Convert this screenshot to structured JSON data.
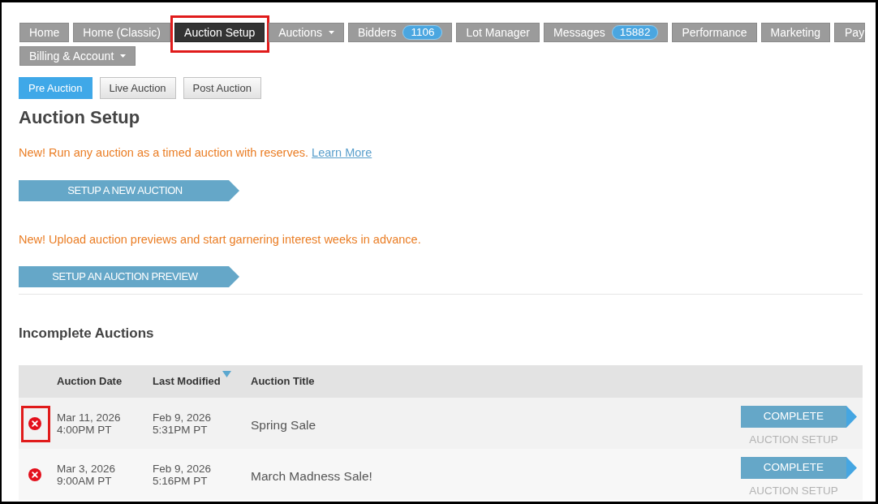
{
  "nav": {
    "rows": [
      [
        {
          "label": "Home",
          "selected": false,
          "menu": false,
          "highlighted": false
        },
        {
          "label": "Home (Classic)",
          "selected": false,
          "menu": false,
          "highlighted": false
        },
        {
          "label": "Auction Setup",
          "selected": true,
          "menu": false,
          "highlighted": true
        },
        {
          "label": "Auctions",
          "selected": false,
          "menu": true,
          "highlighted": false
        },
        {
          "label": "Bidders",
          "badge": "1106",
          "selected": false,
          "menu": false,
          "highlighted": false
        },
        {
          "label": "Lot Manager",
          "selected": false,
          "menu": false,
          "highlighted": false
        },
        {
          "label": "Messages",
          "badge": "15882",
          "selected": false,
          "menu": false,
          "highlighted": false
        },
        {
          "label": "Performance",
          "selected": false,
          "menu": false,
          "highlighted": false
        },
        {
          "label": "Marketing",
          "selected": false,
          "menu": false,
          "highlighted": false
        },
        {
          "label": "Pay",
          "selected": false,
          "menu": false,
          "highlighted": false
        }
      ],
      [
        {
          "label": "Billing & Account",
          "selected": false,
          "menu": true,
          "highlighted": false
        }
      ]
    ]
  },
  "subtabs": [
    {
      "label": "Pre Auction",
      "selected": true
    },
    {
      "label": "Live Auction",
      "selected": false
    },
    {
      "label": "Post Auction",
      "selected": false
    }
  ],
  "title": "Auction Setup",
  "promos": [
    {
      "text": "New! Run any auction as a timed auction with reserves.",
      "link": "Learn More",
      "button": "SETUP A NEW AUCTION"
    },
    {
      "text": "New! Upload auction previews and start garnering interest weeks in advance.",
      "button": "SETUP AN AUCTION PREVIEW"
    }
  ],
  "incomplete": {
    "title": "Incomplete Auctions",
    "columns": [
      {
        "label": "Auction Date",
        "sorted": false
      },
      {
        "label": "Last Modified",
        "sorted": true
      },
      {
        "label": "Auction Title",
        "sorted": false
      }
    ],
    "rows": [
      {
        "auction_date": "Mar 11, 2026",
        "auction_time": "4:00PM PT",
        "modified_date": "Feb 9, 2026",
        "modified_time": "5:31PM PT",
        "title": "Spring Sale",
        "action": "COMPLETE",
        "action_continued": "AUCTION SETUP",
        "highlighted": true
      },
      {
        "auction_date": "Mar 3, 2026",
        "auction_time": "9:00AM PT",
        "modified_date": "Feb 9, 2026",
        "modified_time": "5:16PM PT",
        "title": "March Madness Sale!",
        "action": "COMPLETE",
        "action_continued": "AUCTION SETUP",
        "highlighted": false
      }
    ]
  }
}
